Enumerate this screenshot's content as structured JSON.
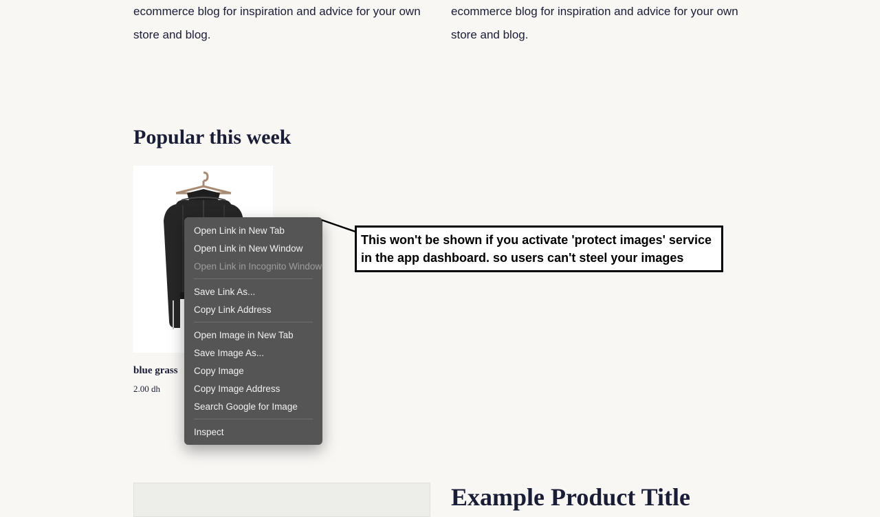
{
  "blurbs": {
    "left": "ecommerce blog for inspiration and advice for your own store and blog.",
    "right": "ecommerce blog for inspiration and advice for your own store and blog."
  },
  "section_heading": "Popular this week",
  "product": {
    "title": "blue grass",
    "price": "2.00 dh"
  },
  "context_menu": {
    "items": [
      {
        "label": "Open Link in New Tab",
        "disabled": false
      },
      {
        "label": "Open Link in New Window",
        "disabled": false
      },
      {
        "label": "Open Link in Incognito Window",
        "disabled": true
      }
    ],
    "group2": [
      {
        "label": "Save Link As..."
      },
      {
        "label": "Copy Link Address"
      }
    ],
    "group3": [
      {
        "label": "Open Image in New Tab"
      },
      {
        "label": "Save Image As..."
      },
      {
        "label": "Copy Image"
      },
      {
        "label": "Copy Image Address"
      },
      {
        "label": "Search Google for Image"
      }
    ],
    "group4": [
      {
        "label": "Inspect"
      }
    ]
  },
  "callout_text": "This won't be shown if you activate 'protect images' service in the app dashboard. so users can't steel your images",
  "example_title": "Example Product Title"
}
